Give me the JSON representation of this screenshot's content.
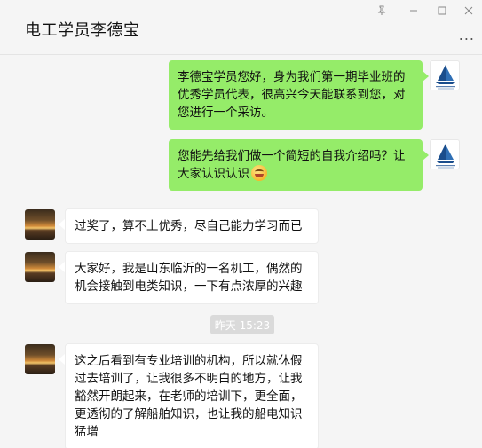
{
  "window": {
    "title": "电工学员李德宝",
    "pin_icon": "pin-icon",
    "minimize_icon": "minimize-icon",
    "maximize_icon": "maximize-icon",
    "close_icon": "close-icon",
    "more_label": "..."
  },
  "messages": [
    {
      "side": "me",
      "text": "李德宝学员您好，身为我们第一期毕业班的优秀学员代表，很高兴今天能联系到您，对您进行一个采访。"
    },
    {
      "side": "me",
      "text": "您能先给我们做一个简短的自我介绍吗？让大家认识认识",
      "emoji": "grin-emoji"
    },
    {
      "side": "other",
      "text": "过奖了，算不上优秀，尽自己能力学习而已"
    },
    {
      "side": "other",
      "text": "大家好，我是山东临沂的一名机工，偶然的机会接触到电类知识，一下有点浓厚的兴趣"
    },
    {
      "side": "other",
      "text": "这之后看到有专业培训的机构，所以就休假过去培训了，让我很多不明白的地方，让我豁然开朗起来，在老师的培训下，更全面，更透彻的了解船舶知识，也让我的船电知识猛增"
    }
  ],
  "timestamp": "昨天 15:23",
  "colors": {
    "me_bubble": "#95ec69",
    "other_bubble": "#ffffff",
    "background": "#f5f5f5"
  }
}
